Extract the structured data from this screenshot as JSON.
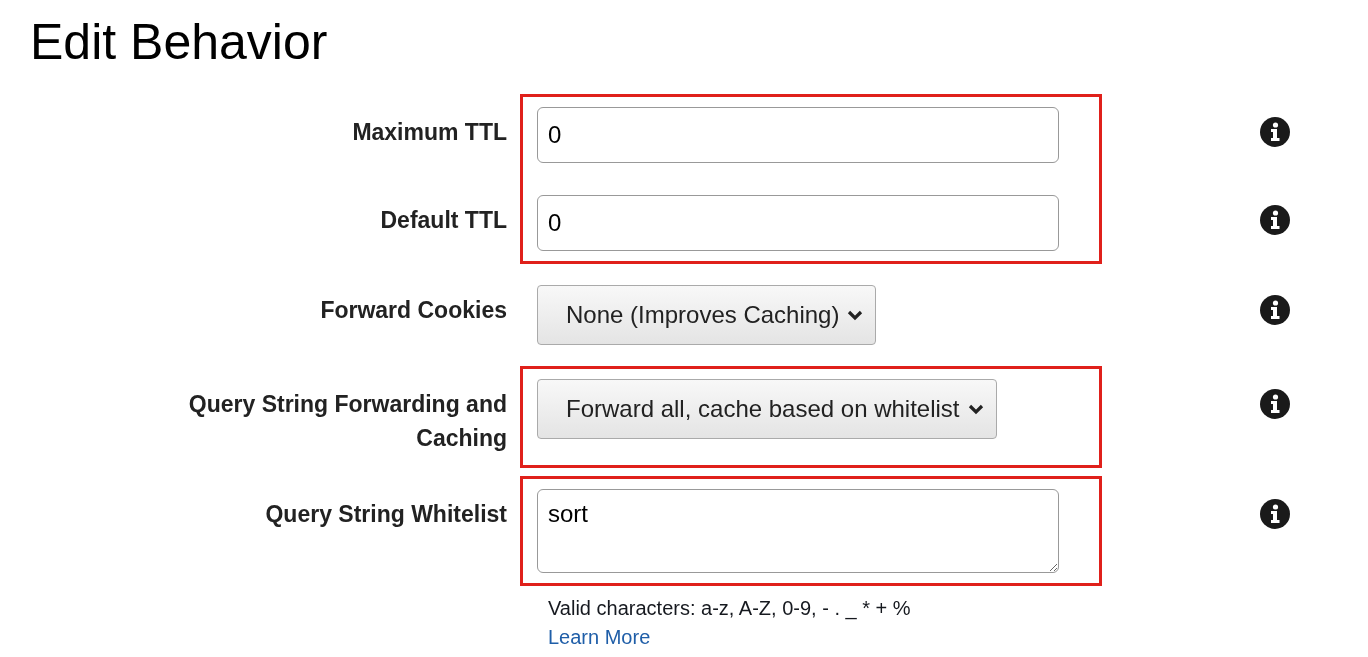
{
  "title": "Edit Behavior",
  "groups": [
    {
      "highlighted": true,
      "rows": [
        {
          "label": "Maximum TTL",
          "kind": "text",
          "value": "0"
        },
        {
          "label": "Default TTL",
          "kind": "text",
          "value": "0"
        }
      ]
    },
    {
      "highlighted": false,
      "rows": [
        {
          "label": "Forward Cookies",
          "kind": "select",
          "value": "None (Improves Caching)"
        }
      ]
    },
    {
      "highlighted": true,
      "rows": [
        {
          "label": "Query String Forwarding and Caching",
          "kind": "select",
          "value": "Forward all, cache based on whitelist"
        }
      ]
    },
    {
      "highlighted": true,
      "rows": [
        {
          "label": "Query String Whitelist",
          "kind": "textarea",
          "value": "sort"
        }
      ]
    }
  ],
  "help": {
    "text": "Valid characters: a-z, A-Z, 0-9, - . _ * + %",
    "link": "Learn More"
  }
}
